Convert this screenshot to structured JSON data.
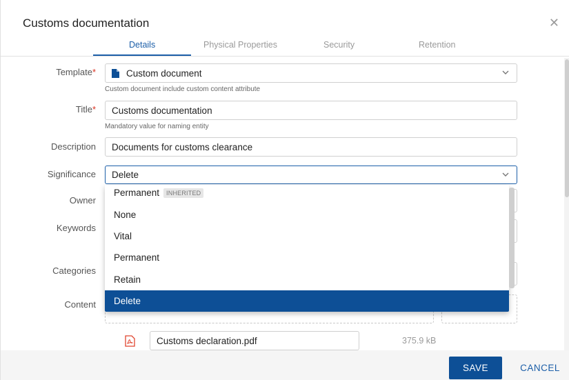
{
  "dialog": {
    "title": "Customs documentation"
  },
  "tabs": [
    {
      "label": "Details"
    },
    {
      "label": "Physical Properties"
    },
    {
      "label": "Security"
    },
    {
      "label": "Retention"
    }
  ],
  "form": {
    "template": {
      "label": "Template",
      "value": "Custom document",
      "hint": "Custom document include custom content attribute"
    },
    "title": {
      "label": "Title",
      "value": "Customs documentation",
      "hint": "Mandatory value for naming entity"
    },
    "description": {
      "label": "Description",
      "value": "Documents for customs clearance"
    },
    "significance": {
      "label": "Significance",
      "value": "Delete"
    },
    "owner": {
      "label": "Owner"
    },
    "keywords": {
      "label": "Keywords"
    },
    "categories": {
      "label": "Categories"
    },
    "content": {
      "label": "Content"
    },
    "required_marker": "*"
  },
  "dropdown": {
    "options": [
      {
        "label": "Permanent",
        "badge": "INHERITED"
      },
      {
        "label": "None"
      },
      {
        "label": "Vital"
      },
      {
        "label": "Permanent"
      },
      {
        "label": "Retain"
      },
      {
        "label": "Delete"
      }
    ],
    "selected": "Delete"
  },
  "file": {
    "name": "Customs declaration.pdf",
    "size": "375.9 kB"
  },
  "footer": {
    "save_label": "SAVE",
    "cancel_label": "CANCEL"
  },
  "icons": {
    "close": "close-icon",
    "chevron": "chevron-down-icon",
    "document": "document-icon",
    "pdf": "pdf-icon"
  },
  "colors": {
    "accent": "#1b5ea8",
    "selected": "#0d4f96",
    "required": "#d9301f"
  }
}
